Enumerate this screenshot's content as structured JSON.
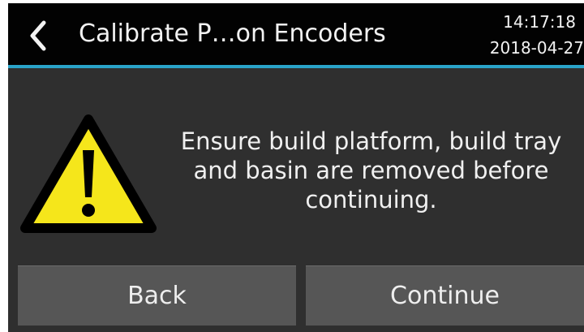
{
  "header": {
    "title": "Calibrate P…on Encoders",
    "time": "14:17:18",
    "date": "2018-04-27"
  },
  "content": {
    "icon": "warning-icon",
    "message": "Ensure build platform, build tray and basin are removed before continuing."
  },
  "buttons": {
    "back_label": "Back",
    "continue_label": "Continue"
  },
  "colors": {
    "accent": "#2aa3c9",
    "warning_fill": "#f5e61b",
    "background": "#2f2f2f",
    "header": "#020202",
    "button": "#565656"
  }
}
